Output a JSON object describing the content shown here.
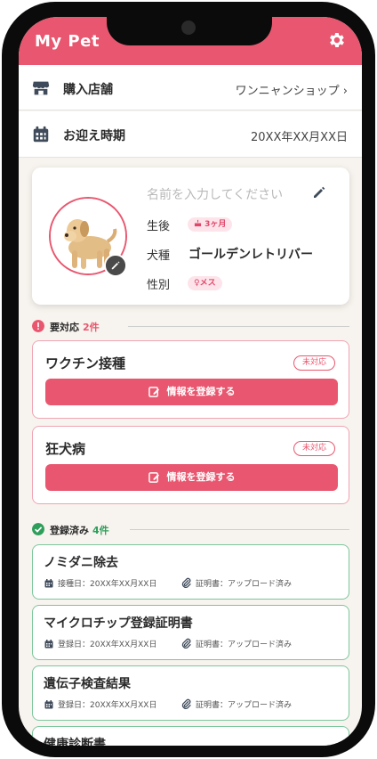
{
  "app": {
    "title": "My Pet"
  },
  "shop": {
    "label": "購入店舗",
    "value": "ワンニャンショップ ›"
  },
  "pickup": {
    "label": "お迎え時期",
    "value": "20XX年XX月XX日"
  },
  "pet": {
    "name_placeholder": "名前を入力してください",
    "age_label": "生後",
    "age_value": "3ヶ月",
    "breed_label": "犬種",
    "breed_value": "ゴールデンレトリバー",
    "sex_label": "性別",
    "sex_value": "♀メス"
  },
  "pending": {
    "title": "要対応",
    "count": "2件",
    "items": [
      {
        "title": "ワクチン接種",
        "status": "未対応",
        "button": "情報を登録する"
      },
      {
        "title": "狂犬病",
        "status": "未対応",
        "button": "情報を登録する"
      }
    ]
  },
  "registered": {
    "title": "登録済み",
    "count": "4件",
    "items": [
      {
        "title": "ノミダニ除去",
        "date": "接種日：20XX年XX月XX日",
        "cert": "証明書：アップロード済み"
      },
      {
        "title": "マイクロチップ登録証明書",
        "date": "登録日：20XX年XX月XX日",
        "cert": "証明書：アップロード済み"
      },
      {
        "title": "遺伝子検査結果",
        "date": "登録日：20XX年XX月XX日",
        "cert": "証明書：アップロード済み"
      },
      {
        "title": "健康診断書"
      }
    ]
  },
  "colors": {
    "accent": "#e8576f",
    "success": "#2e9e5b",
    "background": "#f7f3ee"
  },
  "icons": {
    "settings": "gear-icon",
    "shop": "shop-icon",
    "calendar": "calendar-icon",
    "edit": "pencil-icon",
    "alert": "alert-icon",
    "check": "check-circle-icon",
    "attachment": "paperclip-icon"
  }
}
